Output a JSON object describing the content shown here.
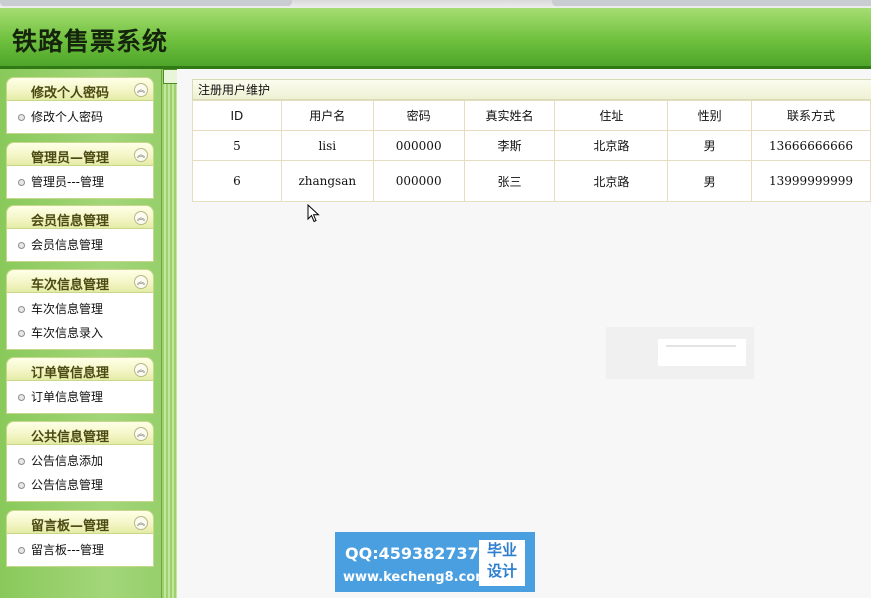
{
  "header": {
    "title": "铁路售票系统"
  },
  "sidebar": {
    "groups": [
      {
        "title": "修改个人密码",
        "items": [
          "修改个人密码"
        ]
      },
      {
        "title": "管理员—管理",
        "items": [
          "管理员---管理"
        ]
      },
      {
        "title": "会员信息管理",
        "items": [
          "会员信息管理"
        ]
      },
      {
        "title": "车次信息管理",
        "items": [
          "车次信息管理",
          "车次信息录入"
        ]
      },
      {
        "title": "订单管信息理",
        "items": [
          "订单信息管理"
        ]
      },
      {
        "title": "公共信息管理",
        "items": [
          "公告信息添加",
          "公告信息管理"
        ]
      },
      {
        "title": "留言板—管理",
        "items": [
          "留言板---管理"
        ]
      }
    ]
  },
  "panel": {
    "title": "注册用户维护",
    "columns": [
      "ID",
      "用户名",
      "密码",
      "真实姓名",
      "住址",
      "性别",
      "联系方式"
    ],
    "rows": [
      [
        "5",
        "lisi",
        "000000",
        "李斯",
        "北京路",
        "男",
        "13666666666"
      ],
      [
        "6",
        "zhangsan",
        "000000",
        "张三",
        "北京路",
        "男",
        "13999999999"
      ]
    ]
  },
  "watermark": {
    "qq": "QQ:459382737",
    "site": "www.kecheng8.com",
    "badge_line1": "毕业",
    "badge_line2": "设计"
  }
}
